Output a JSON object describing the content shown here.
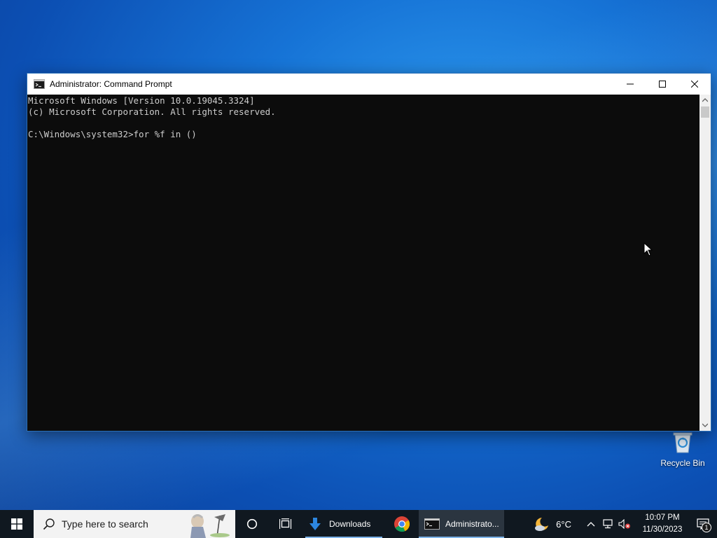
{
  "window": {
    "title": "Administrator: Command Prompt",
    "console_lines": [
      "Microsoft Windows [Version 10.0.19045.3324]",
      "(c) Microsoft Corporation. All rights reserved.",
      "",
      "C:\\Windows\\system32>for %f in ()"
    ]
  },
  "desktop": {
    "icons": [
      {
        "label": "Recycle Bin",
        "icon": "recycle-bin-icon"
      }
    ]
  },
  "taskbar": {
    "search_placeholder": "Type here to search",
    "apps": [
      {
        "label": "Downloads",
        "icon": "folder-download-icon"
      },
      {
        "label": "",
        "icon": "chrome-icon"
      },
      {
        "label": "Administrato...",
        "icon": "cmd-icon"
      }
    ],
    "weather": {
      "temp": "6°C",
      "icon": "moon-cloud-icon"
    },
    "clock": {
      "time": "10:07 PM",
      "date": "11/30/2023"
    },
    "notification_count": "1"
  },
  "colors": {
    "console_bg": "#0c0c0c",
    "console_fg": "#cccccc",
    "taskbar_bg": "#101820",
    "active_app_bg": "#2b3540",
    "accent": "#7eb4ea"
  }
}
